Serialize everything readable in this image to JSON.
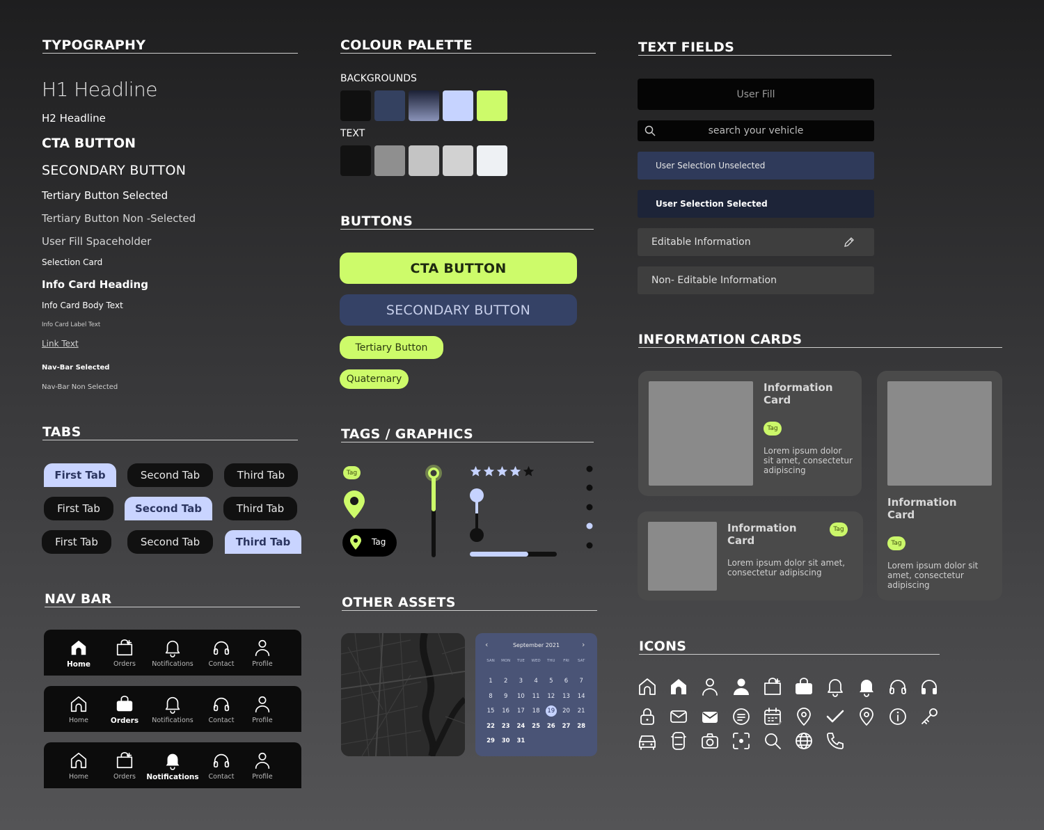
{
  "typography": {
    "title": "TYPOGRAPHY",
    "h1": "H1 Headline",
    "h2": "H2 Headline",
    "cta": "CTA BUTTON",
    "secondary": "SECONDARY BUTTON",
    "tertiary_selected": "Tertiary Button Selected",
    "tertiary_non": "Tertiary Button Non -Selected",
    "user_fill": "User Fill Spaceholder",
    "selection_card": "Selection Card",
    "info_heading": "Info Card Heading",
    "info_body": "Info Card Body Text",
    "info_label": "Info Card Label Text",
    "link": "Link Text",
    "nav_selected": "Nav-Bar Selected",
    "nav_non": "Nav-Bar Non Selected"
  },
  "palette": {
    "title": "COLOUR PALETTE",
    "backgrounds_label": "BACKGROUNDS",
    "text_label": "TEXT",
    "backgrounds": [
      "#101010",
      "#344160",
      "gradient:#1c2136-#8a93b8",
      "#c6d3ff",
      "#cdfb6a"
    ],
    "text": [
      "#121212",
      "#8f8f8f",
      "#c4c4c4",
      "#d2d2d2",
      "#eef1f4"
    ]
  },
  "buttons": {
    "title": "BUTTONS",
    "cta": "CTA BUTTON",
    "secondary": "SECONDARY BUTTON",
    "tertiary": "Tertiary Button",
    "quaternary": "Quaternary"
  },
  "tabs": {
    "title": "TABS",
    "rows": [
      [
        "First Tab",
        "Second Tab",
        "Third Tab"
      ],
      [
        "First Tab",
        "Second Tab",
        "Third Tab"
      ],
      [
        "First Tab",
        "Second Tab",
        "Third Tab"
      ]
    ]
  },
  "navbar": {
    "title": "NAV BAR",
    "items": [
      "Home",
      "Orders",
      "Notifications",
      "Contact",
      "Profile"
    ]
  },
  "tags_graphics": {
    "title": "TAGS /  GRAPHICS",
    "tag_small": "Tag",
    "tag_pill": "Tag",
    "rating": 4,
    "rating_max": 5,
    "progress": 0.67
  },
  "other_assets": {
    "title": "OTHER ASSETS",
    "calendar": {
      "month": "September 2021",
      "days": [
        "SAN",
        "MON",
        "TUE",
        "WED",
        "THU",
        "FRI",
        "SAT"
      ],
      "weeks": [
        [
          "1",
          "2",
          "3",
          "4",
          "5",
          "6",
          "7"
        ],
        [
          "8",
          "9",
          "10",
          "11",
          "12",
          "13",
          "14"
        ],
        [
          "15",
          "16",
          "17",
          "18",
          "19",
          "20",
          "21"
        ],
        [
          "22",
          "23",
          "24",
          "25",
          "26",
          "27",
          "28"
        ],
        [
          "29",
          "30",
          "31",
          "",
          "",
          "",
          ""
        ]
      ],
      "selected": "19"
    }
  },
  "text_fields": {
    "title": "TEXT FIELDS",
    "user_fill": "User Fill",
    "search_placeholder": "search your vehicle",
    "unselected": "User Selection Unselected",
    "selected": "User Selection Selected",
    "editable": "Editable Information",
    "non_editable": "Non- Editable Information"
  },
  "info_cards": {
    "title": "INFORMATION CARDS",
    "card_title": "Information Card",
    "tag": "Tag",
    "body": "Lorem ipsum dolor sit amet, consectetur adipiscing"
  },
  "icons": {
    "title": "ICONS",
    "names": [
      "home-outline-icon",
      "home-filled-icon",
      "user-outline-icon",
      "user-filled-icon",
      "bag-add-icon",
      "bag-filled-icon",
      "bell-outline-icon",
      "bell-filled-icon",
      "headphones-outline-icon",
      "headphones-filled-icon",
      "lock-icon",
      "mail-outline-icon",
      "mail-filled-icon",
      "message-icon",
      "calendar-icon",
      "location-check-icon",
      "check-icon",
      "location-icon",
      "info-icon",
      "key-icon",
      "car-front-icon",
      "car-top-icon",
      "camera-icon",
      "scan-icon",
      "search-icon",
      "globe-icon",
      "phone-icon"
    ]
  }
}
